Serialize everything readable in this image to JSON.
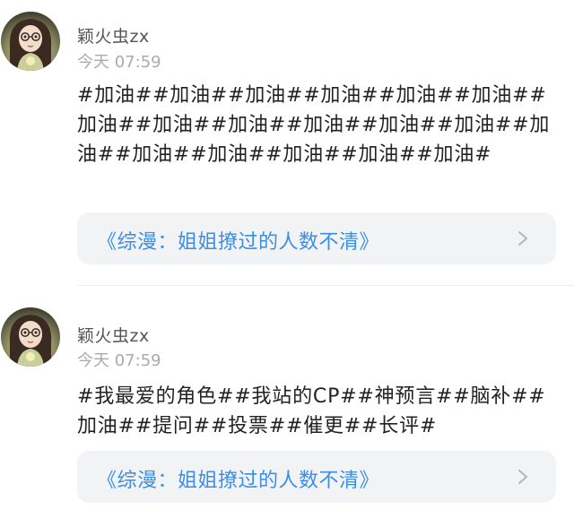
{
  "posts": [
    {
      "username": "颖火虫zx",
      "timestamp": "今天 07:59",
      "content": "#加油##加油##加油##加油##加油##加油##加油##加油##加油##加油##加油##加油##加油##加油##加油##加油##加油##加油#",
      "card_title": "《综漫：姐姐撩过的人数不清》",
      "avatar_icon": "avatar-girl-with-glasses-icon",
      "arrow_icon": "chevron-right-icon"
    },
    {
      "username": "颖火虫zx",
      "timestamp": "今天 07:59",
      "content": "#我最爱的角色##我站的CP##神预言##脑补##加油##提问##投票##催更##长评#",
      "card_title": "《综漫：姐姐撩过的人数不清》",
      "avatar_icon": "avatar-girl-with-glasses-icon",
      "arrow_icon": "chevron-right-icon"
    }
  ],
  "colors": {
    "link": "#3a8ee6",
    "card_bg": "#f2f3f5",
    "username": "#555555",
    "timestamp": "#aaaaaa",
    "text": "#222222"
  }
}
